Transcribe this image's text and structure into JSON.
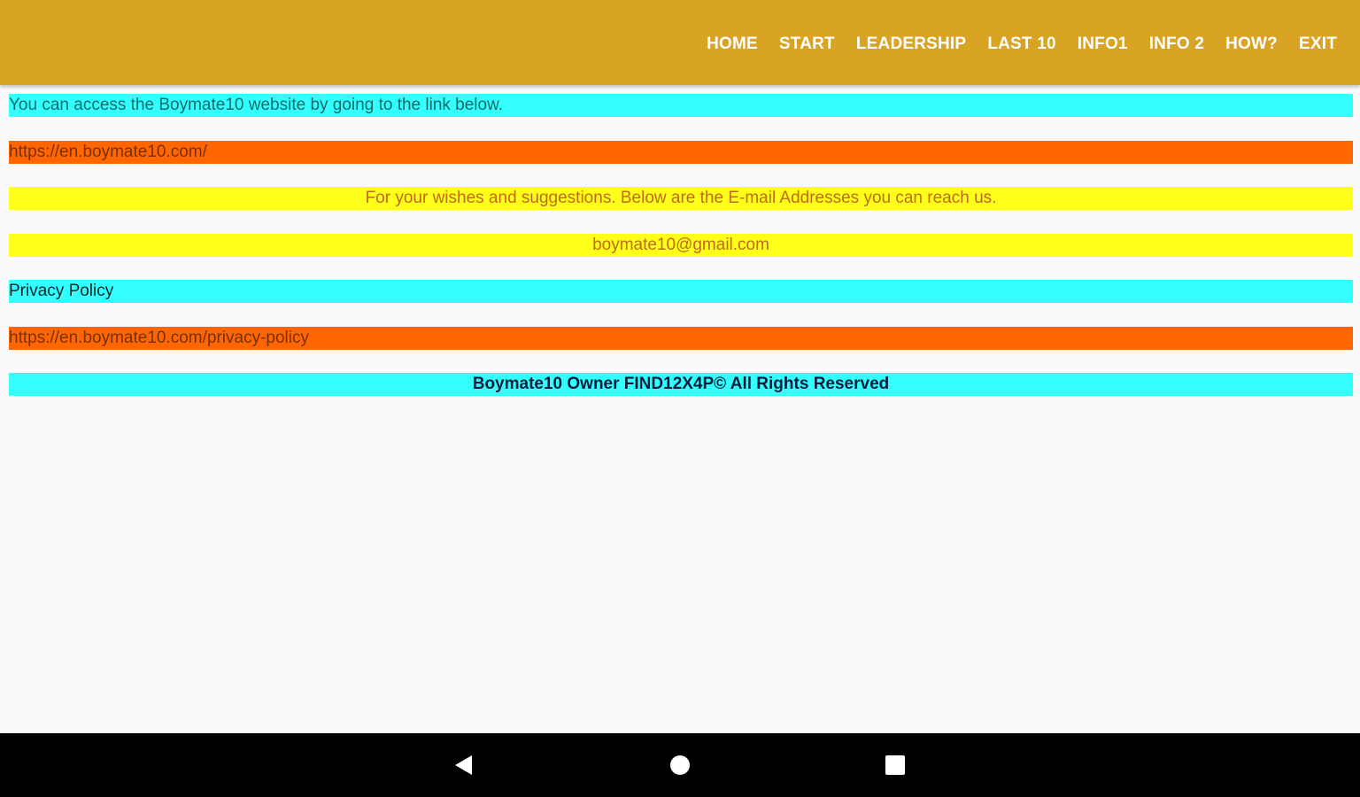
{
  "menu": {
    "items": [
      "HOME",
      "START",
      "LEADERSHIP",
      "LAST 10",
      "INFO1",
      "INFO 2",
      "HOW?",
      "EXIT"
    ]
  },
  "content": {
    "access_text": "You can access the Boymate10 website by going to the link below.",
    "website_link": "https://en.boymate10.com/",
    "wishes_text": "For your wishes and suggestions. Below are the E-mail Addresses you can reach us.",
    "email": "boymate10@gmail.com",
    "privacy_label": "Privacy Policy",
    "privacy_link": "https://en.boymate10.com/privacy-policy",
    "footer": "Boymate10 Owner FIND12X4P© All Rights Reserved"
  },
  "colors": {
    "app_bar": "#d9a323",
    "cyan": "#33ffff",
    "orange": "#ff6600",
    "yellow": "#ffff1a",
    "nav_bar": "#000000"
  },
  "navigation": {
    "icons": [
      "back-icon",
      "home-icon",
      "recent-apps-icon"
    ]
  }
}
